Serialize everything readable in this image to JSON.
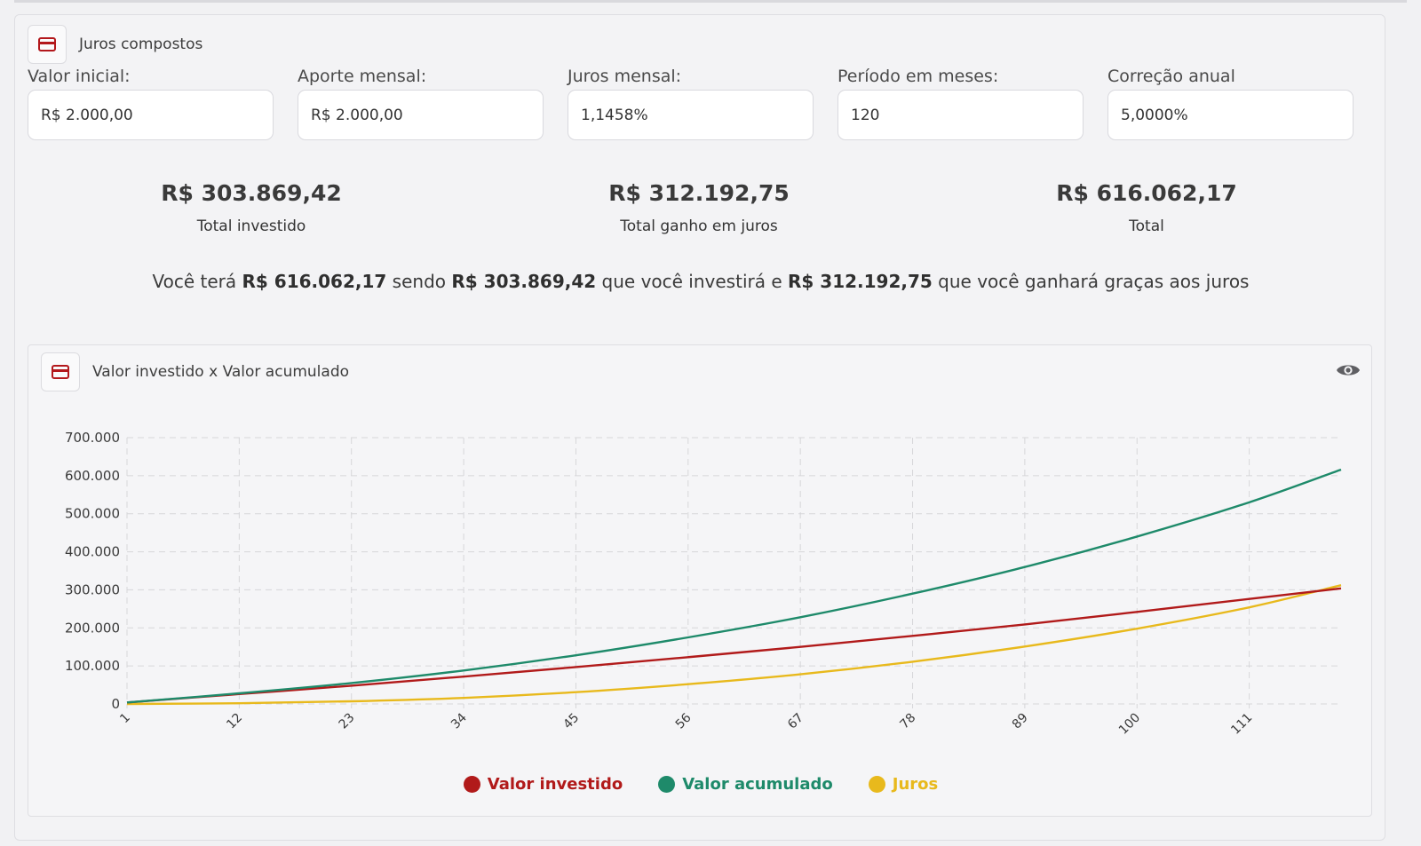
{
  "header": {
    "title": "Juros compostos",
    "icon": "credit-card-icon"
  },
  "fields": [
    {
      "label": "Valor inicial:",
      "value": "R$ 2.000,00"
    },
    {
      "label": "Aporte mensal:",
      "value": "R$ 2.000,00"
    },
    {
      "label": "Juros mensal:",
      "value": "1,1458%"
    },
    {
      "label": "Período em meses:",
      "value": "120"
    },
    {
      "label": "Correção anual",
      "value": "5,0000%"
    }
  ],
  "stats": [
    {
      "value": "R$ 303.869,42",
      "label": "Total investido"
    },
    {
      "value": "R$ 312.192,75",
      "label": "Total ganho em juros"
    },
    {
      "value": "R$ 616.062,17",
      "label": "Total"
    }
  ],
  "summary": {
    "p1": "Você terá ",
    "total": "R$ 616.062,17",
    "p2": " sendo ",
    "invested": "R$ 303.869,42",
    "p3": " que você investirá e ",
    "interest": "R$ 312.192,75",
    "p4": " que você ganhará graças aos juros"
  },
  "chart_card": {
    "title": "Valor investido x Valor acumulado",
    "icon": "credit-card-icon",
    "toggle_icon": "eye-icon"
  },
  "colors": {
    "invested": "#b11a1a",
    "accumulated": "#1e8a6a",
    "interest": "#e8b91c",
    "grid": "#d6d6d9"
  },
  "chart_data": {
    "type": "line",
    "x": [
      1,
      12,
      23,
      34,
      45,
      56,
      67,
      78,
      89,
      100,
      111,
      120
    ],
    "x_tick_labels": [
      "1",
      "12",
      "23",
      "34",
      "45",
      "56",
      "67",
      "78",
      "89",
      "100",
      "111"
    ],
    "y_tick_labels": [
      "0",
      "100.000",
      "200.000",
      "300.000",
      "400.000",
      "500.000",
      "600.000",
      "700.000"
    ],
    "ylim": [
      0,
      700000
    ],
    "grid": true,
    "legend_position": "bottom",
    "series": [
      {
        "name": "Valor investido",
        "color": "#b11a1a",
        "values": [
          4000,
          26000,
          48000,
          72000,
          97000,
          123000,
          150000,
          179000,
          209000,
          242000,
          276000,
          303869
        ]
      },
      {
        "name": "Valor acumulado",
        "color": "#1e8a6a",
        "values": [
          4000,
          28000,
          55000,
          88000,
          128000,
          175000,
          228000,
          290000,
          360000,
          440000,
          530000,
          616062
        ]
      },
      {
        "name": "Juros",
        "color": "#e8b91c",
        "values": [
          0,
          2000,
          7000,
          16000,
          31000,
          52000,
          78000,
          111000,
          151000,
          198000,
          254000,
          312193
        ]
      }
    ]
  }
}
